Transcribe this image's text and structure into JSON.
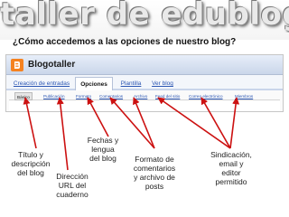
{
  "banner": {
    "title": "taller de edublogs"
  },
  "question": "¿Cómo accedemos a las opciones de nuestro blog?",
  "blogger": {
    "blog_name": "Blogotaller",
    "logo_icon": "blogger-b-icon",
    "tabs": [
      {
        "label": "Creación de entradas",
        "active": false
      },
      {
        "label": "Opciones",
        "active": true
      },
      {
        "label": "Plantilla",
        "active": false
      },
      {
        "label": "Ver blog",
        "active": false
      }
    ],
    "subtabs": [
      {
        "label": "Básico",
        "active": true
      },
      {
        "label": "Publicación",
        "active": false
      },
      {
        "label": "Formato",
        "active": false
      },
      {
        "label": "Comentarios",
        "active": false
      },
      {
        "label": "Archivo",
        "active": false
      },
      {
        "label": "Feed del sitio",
        "active": false
      },
      {
        "label": "Correo electrónico",
        "active": false
      },
      {
        "label": "Miembros",
        "active": false
      }
    ]
  },
  "annotations": {
    "titulo": "Título y\ndescripción\ndel blog",
    "direccion": "Dirección\nURL del\ncuaderno",
    "fechas": "Fechas y\nlengua\ndel blog",
    "formato": "Formato de\ncomentarios\ny archivo de\nposts",
    "sindicacion": "Sindicación,\nemail y\neditor\npermitido"
  },
  "colors": {
    "arrow": "#cc1111",
    "tab_link": "#2b56b3",
    "logo": "#f58220"
  }
}
